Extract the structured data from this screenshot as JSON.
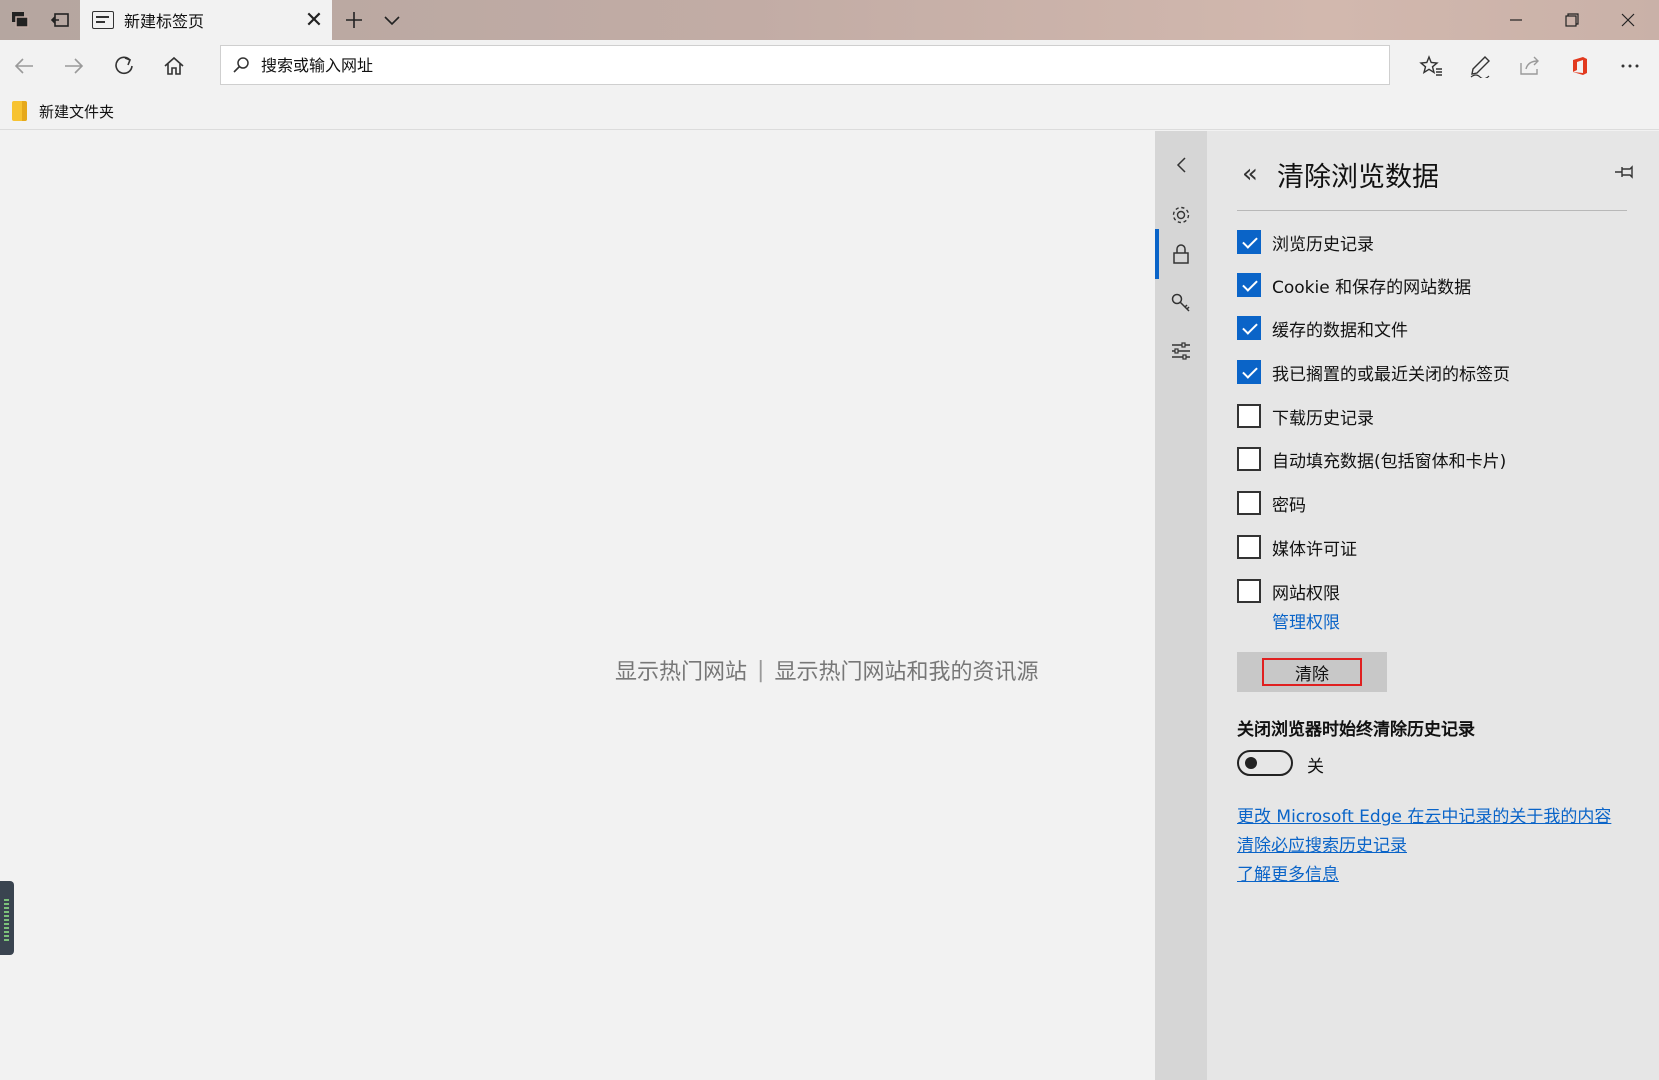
{
  "tab": {
    "title": "新建标签页"
  },
  "address_bar": {
    "placeholder": "搜索或输入网址",
    "value": ""
  },
  "favorites_bar": {
    "items": [
      {
        "label": "新建文件夹"
      }
    ]
  },
  "new_tab_page": {
    "show_top_sites": "显示热门网站",
    "separator": "|",
    "show_top_sites_and_feed": "显示热门网站和我的资讯源"
  },
  "panel": {
    "title": "清除浏览数据",
    "checkboxes": [
      {
        "label": "浏览历史记录",
        "checked": true
      },
      {
        "label": "Cookie 和保存的网站数据",
        "checked": true
      },
      {
        "label": "缓存的数据和文件",
        "checked": true
      },
      {
        "label": "我已搁置的或最近关闭的标签页",
        "checked": true
      },
      {
        "label": "下载历史记录",
        "checked": false
      },
      {
        "label": "自动填充数据(包括窗体和卡片)",
        "checked": false
      },
      {
        "label": "密码",
        "checked": false
      },
      {
        "label": "媒体许可证",
        "checked": false
      },
      {
        "label": "网站权限",
        "checked": false
      }
    ],
    "manage_permissions_link": "管理权限",
    "clear_button": "清除",
    "always_clear_label": "关闭浏览器时始终清除历史记录",
    "toggle": {
      "state_label": "关",
      "on": false
    },
    "links": [
      "更改 Microsoft Edge 在云中记录的关于我的内容",
      "清除必应搜索历史记录",
      "了解更多信息"
    ]
  },
  "colors": {
    "accent": "#0a64c8",
    "clear_button_outline": "#e02020",
    "office_icon": "#e23a1f"
  }
}
